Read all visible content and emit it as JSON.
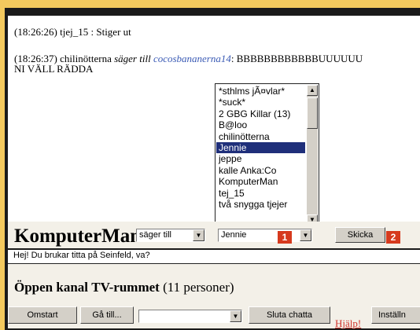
{
  "chat": {
    "lines": [
      {
        "time": "(18:26:26)",
        "text": "tjej_15 : Stiger ut"
      },
      {
        "time": "(18:26:37)",
        "sender": "chilinötterna",
        "verb": "säger till",
        "to": "cocosbananerna14",
        "text": ": BBBBBBBBBBBBUUUUUU",
        "cont": "NI VÄLL RÄDDA"
      }
    ]
  },
  "users": {
    "items": [
      "*sthlms jÃ¤vlar*",
      "*suck*",
      "2 GBG Killar (13)",
      "B@loo",
      "chilinötterna",
      "Jennie",
      "jeppe",
      "kalle Anka:Co",
      "KomputerMan",
      "tej_15",
      "två snygga tjejer"
    ],
    "selected_index": 5,
    "scroll_up": "▲",
    "scroll_down": "▼"
  },
  "compose": {
    "nick": "KomputerMan",
    "mode": "säger till",
    "recipient": "Jennie",
    "send": "Skicka",
    "badge1": "1",
    "badge2": "2",
    "message": "Hej! Du brukar titta på Seinfeld, va?"
  },
  "channel": {
    "prefix": "Öppen kanal",
    "name": "TV-rummet",
    "count": "(11 personer)"
  },
  "toolbar": {
    "restart": "Omstart",
    "goto": "Gå till...",
    "goto_value": "",
    "quit": "Sluta chatta",
    "help": "Hjälp!",
    "settings": "Inställn"
  },
  "colors": {
    "background": "#f3c95e",
    "selection": "#1f2f7a",
    "badge": "#d63a1e",
    "link": "#3b5bb5"
  }
}
